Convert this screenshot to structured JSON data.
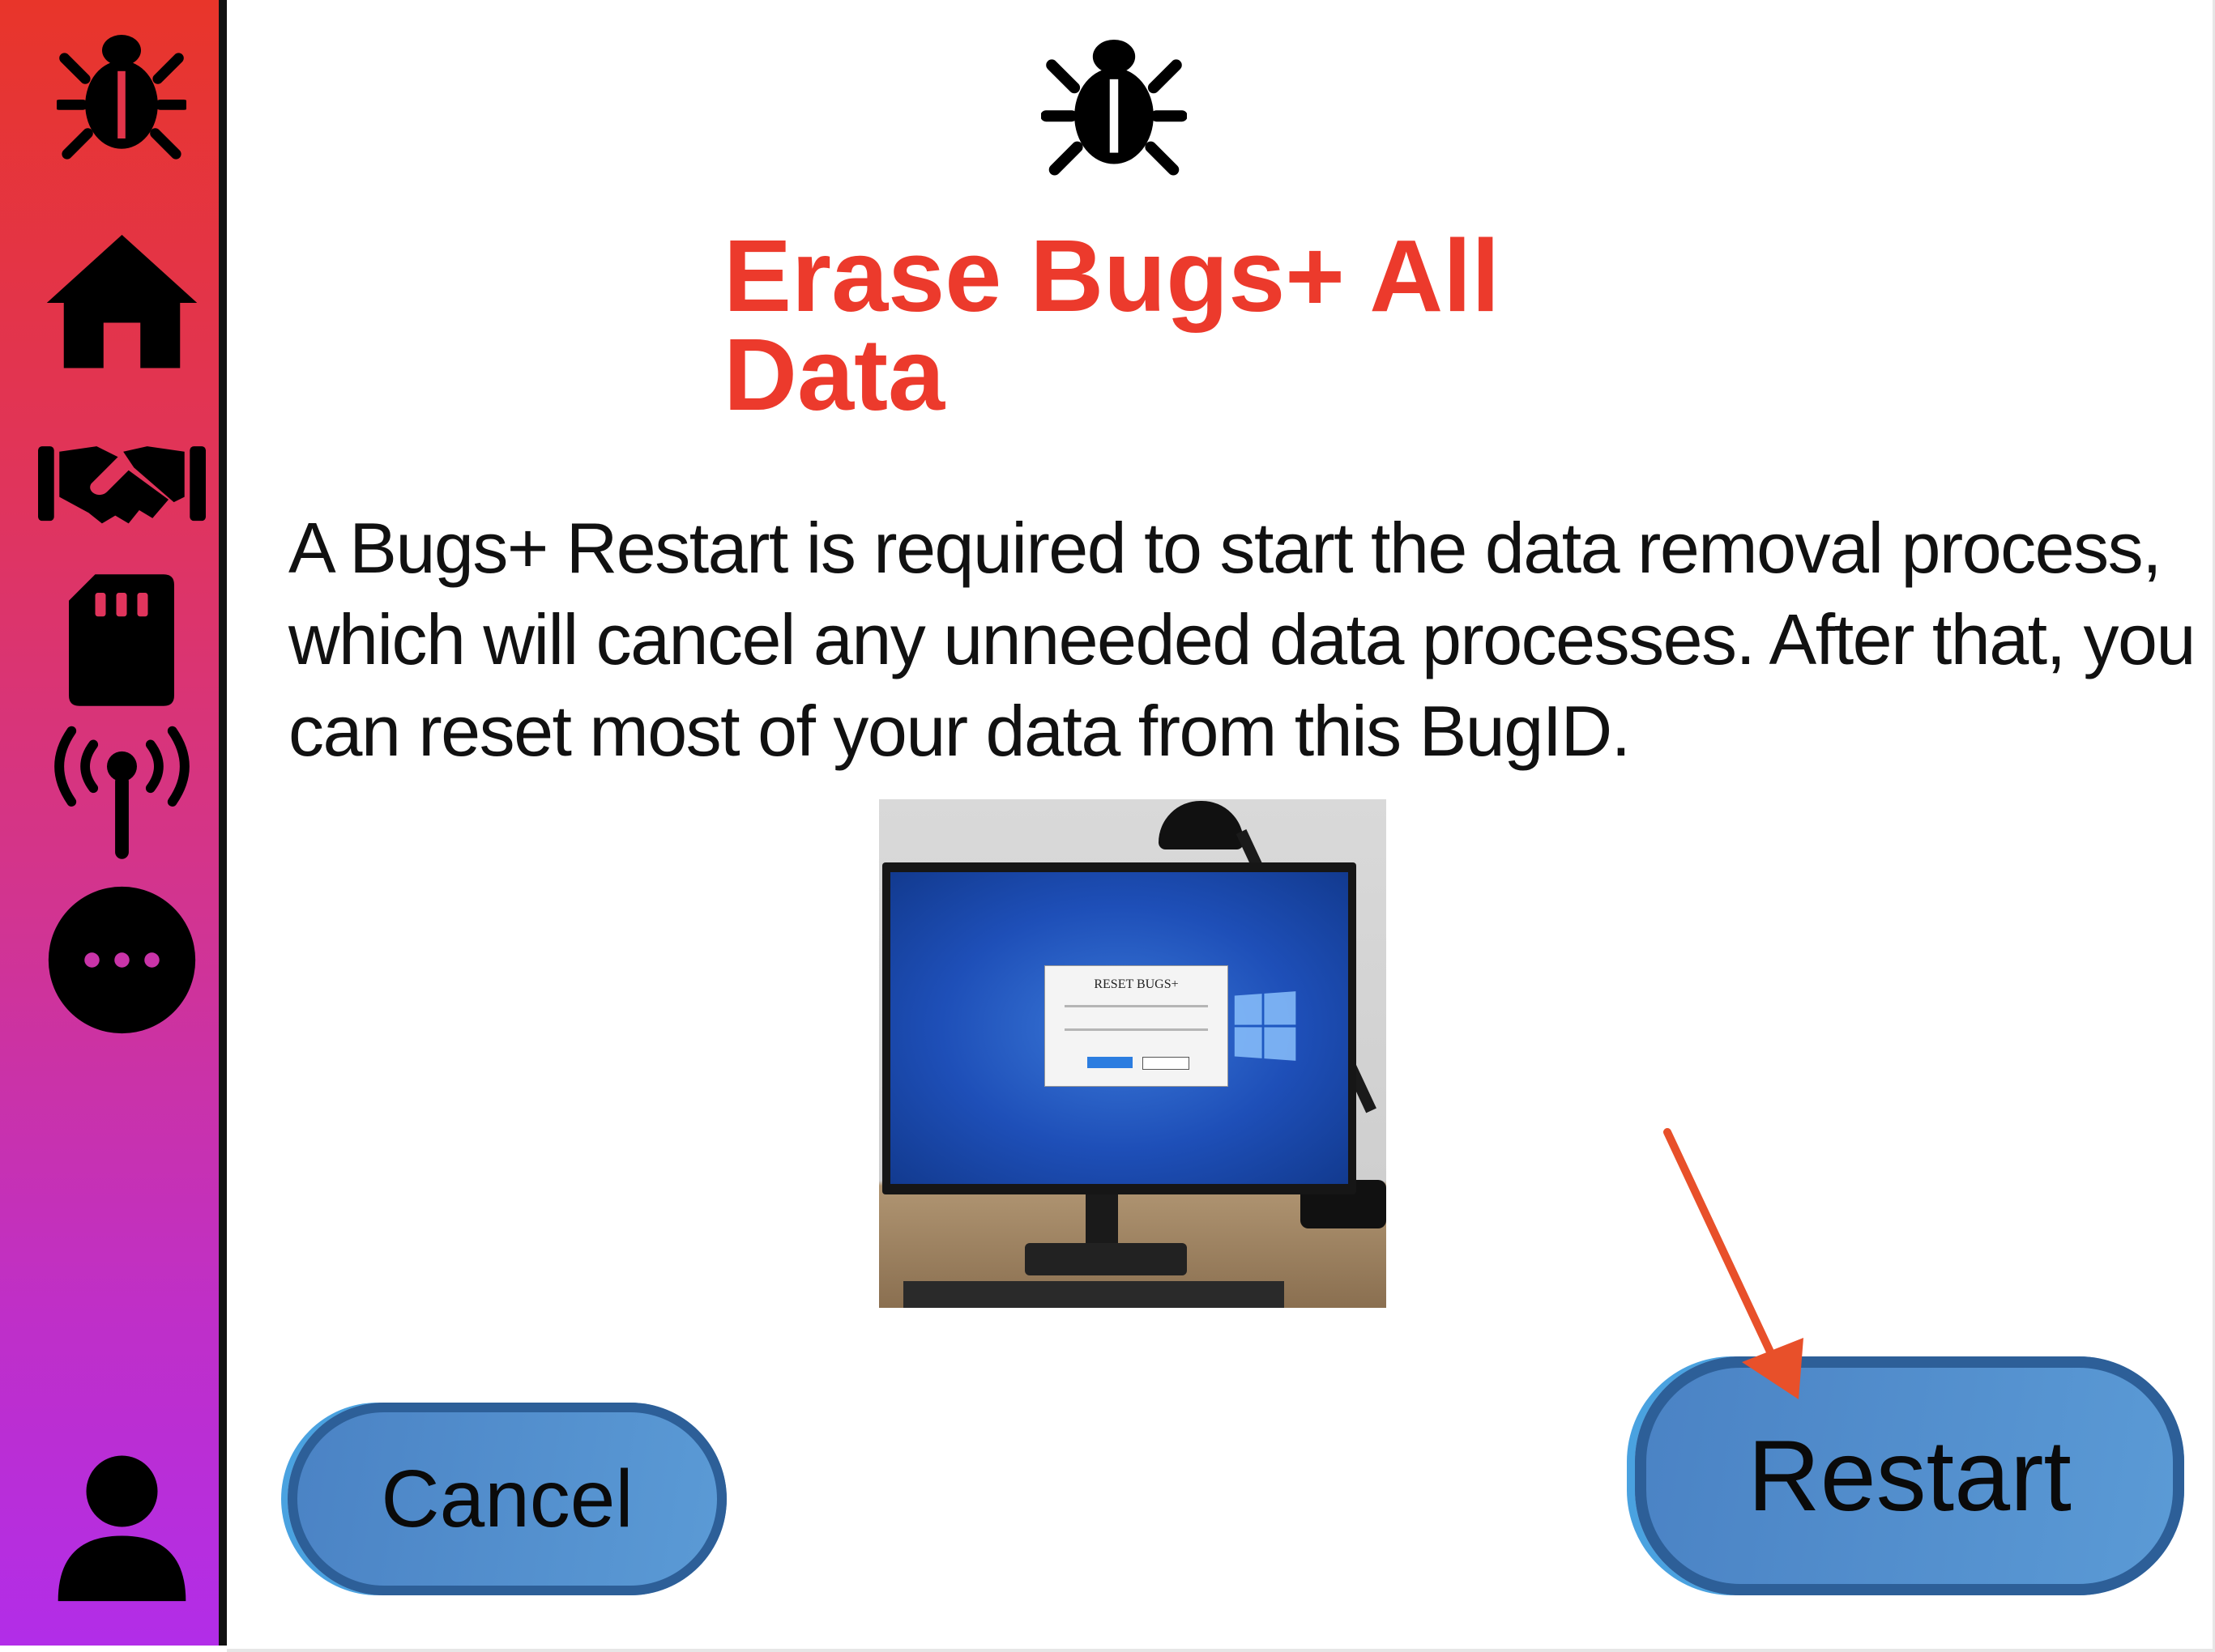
{
  "sidebar": {
    "items": [
      {
        "icon": "bug-icon"
      },
      {
        "icon": "home-icon"
      },
      {
        "icon": "handshake-icon"
      },
      {
        "icon": "sd-card-icon"
      },
      {
        "icon": "antenna-icon"
      },
      {
        "icon": "more-icon"
      },
      {
        "icon": "user-icon"
      }
    ]
  },
  "dialog": {
    "title": "Erase Bugs+ All Data",
    "description": "A Bugs+ Restart is required to start the data removal process, which will cancel any unneeded data processes. After that, you can reset most of your data from this BugID.",
    "image_dialog_title": "RESET BUGS+",
    "cancel_label": "Cancel",
    "restart_label": "Restart"
  },
  "colors": {
    "title": "#ec3a2c",
    "button": "#5b9bd6",
    "arrow": "#e8502a",
    "sidebar_top": "#e8352a",
    "sidebar_bottom": "#b22de8"
  }
}
